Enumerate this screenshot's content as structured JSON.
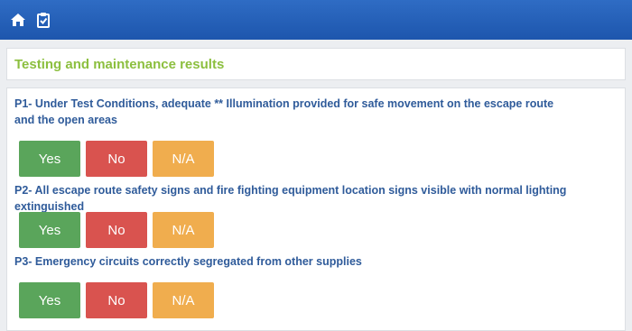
{
  "toolbar": {
    "icons": [
      "home-icon",
      "clipboard-check-icon"
    ],
    "color": "#1d56ad"
  },
  "section": {
    "title": "Testing and maintenance results"
  },
  "questions": [
    {
      "lines": [
        "P1- Under Test Conditions, adequate ** Illumination provided for safe movement on the escape route",
        "and the open areas"
      ],
      "options": [
        "Yes",
        "No",
        "N/A"
      ]
    },
    {
      "lines": [
        "P2- All escape route safety signs and fire fighting equipment location signs visible with normal lighting extinguished"
      ],
      "options": [
        "Yes",
        "No",
        "N/A"
      ]
    },
    {
      "lines": [
        "P3- Emergency circuits correctly segregated from other supplies"
      ],
      "options": [
        "Yes",
        "No",
        "N/A"
      ]
    }
  ],
  "colors": {
    "yes": "#5aa55b",
    "no": "#d9534f",
    "na": "#f0ad4e",
    "title": "#8cbf3f",
    "question": "#2f5b9a"
  }
}
